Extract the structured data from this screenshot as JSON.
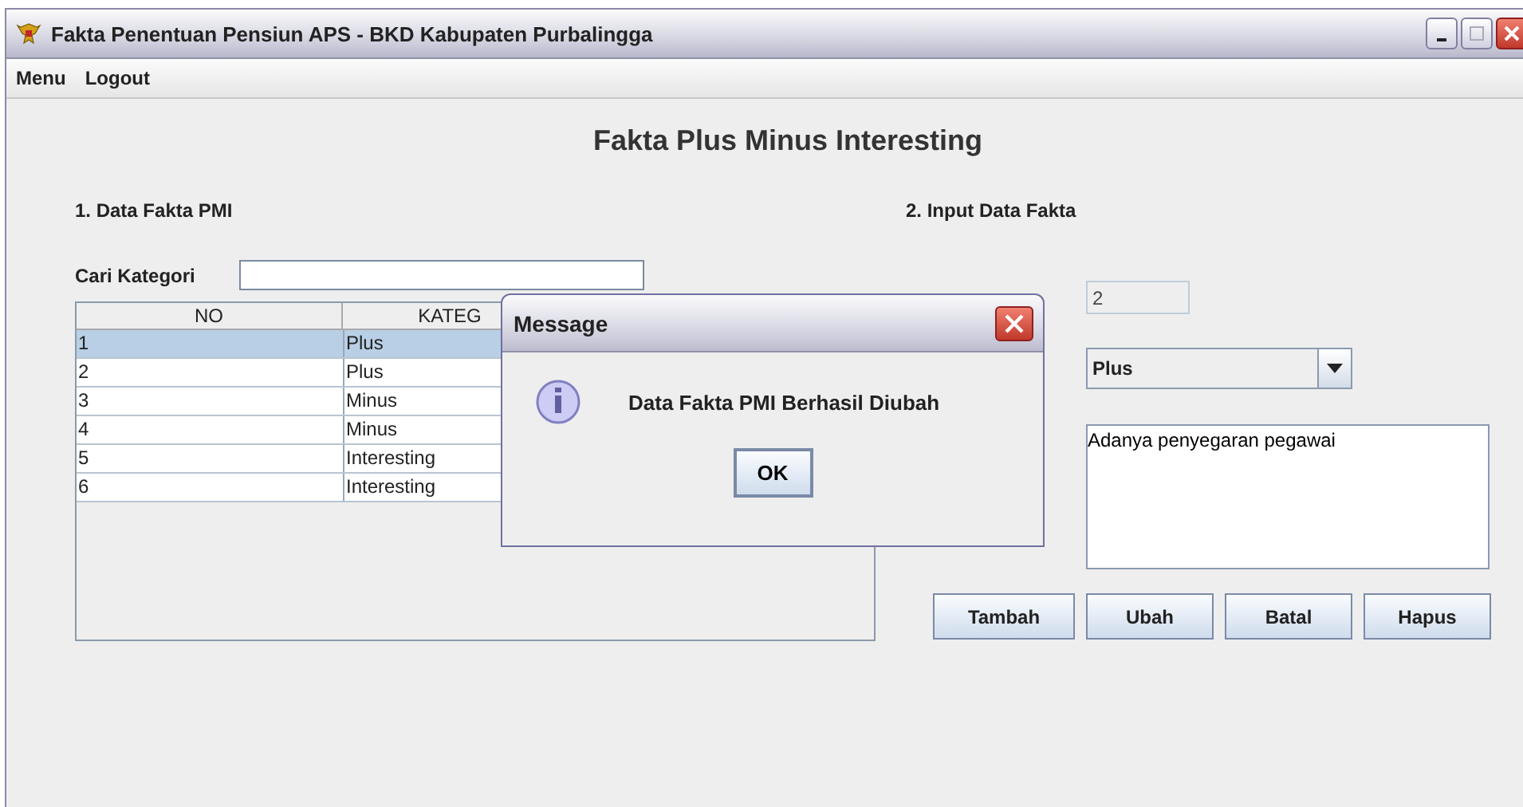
{
  "window": {
    "title": "Fakta Penentuan Pensiun APS - BKD Kabupaten Purbalingga"
  },
  "menu": [
    "Menu",
    "Logout"
  ],
  "heading": "Fakta Plus Minus Interesting",
  "left_panel": {
    "title": "1. Data Fakta PMI",
    "search_label": "Cari Kategori",
    "table": {
      "columns": [
        "NO",
        "KATEG"
      ],
      "rows": [
        {
          "cells": [
            "1",
            "Plus"
          ],
          "selected": true
        },
        {
          "cells": [
            "2",
            "Plus"
          ],
          "selected": false
        },
        {
          "cells": [
            "3",
            "Minus"
          ],
          "selected": false
        },
        {
          "cells": [
            "4",
            "Minus"
          ],
          "selected": false
        },
        {
          "cells": [
            "5",
            "Interesting"
          ],
          "selected": false
        },
        {
          "cells": [
            "6",
            "Interesting"
          ],
          "selected": false
        }
      ]
    }
  },
  "right_panel": {
    "title": "2. Input Data Fakta",
    "id_field": {
      "value": "2",
      "disabled": true
    },
    "category": "Plus",
    "description": "Adanya penyegaran pegawai",
    "buttons": [
      "Tambah",
      "Ubah",
      "Batal",
      "Hapus"
    ]
  },
  "dialog": {
    "title": "Message",
    "message": "Data Fakta PMI Berhasil Diubah",
    "button": "OK"
  }
}
